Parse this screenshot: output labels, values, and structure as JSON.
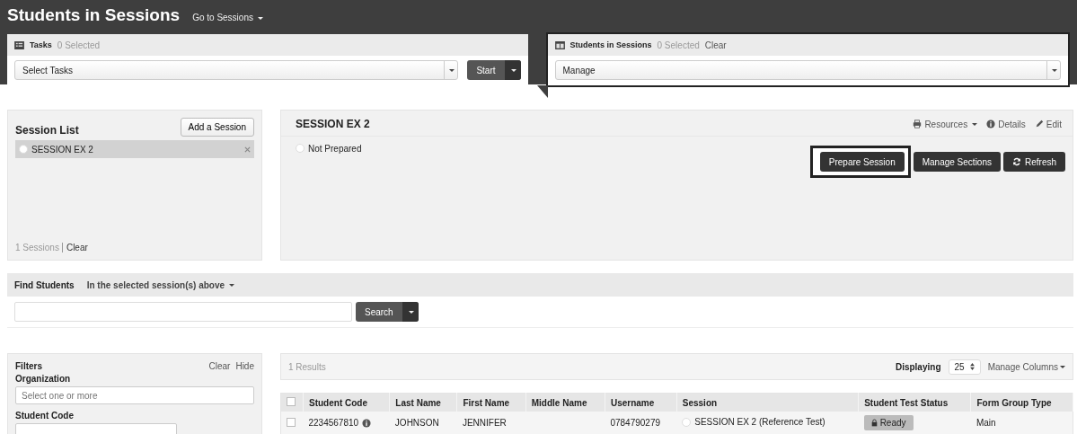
{
  "header": {
    "title": "Students in Sessions",
    "nav_link": "Go to Sessions"
  },
  "tasks_panel": {
    "title": "Tasks",
    "count": "0 Selected",
    "select_value": "Select Tasks",
    "start_button": "Start"
  },
  "students_panel": {
    "title": "Students in Sessions",
    "count": "0 Selected",
    "clear_link": "Clear",
    "select_value": "Manage"
  },
  "session_list": {
    "title": "Session List",
    "add_button": "Add a Session",
    "items": [
      {
        "name": "SESSION EX 2",
        "selected": true,
        "radio_selected": false
      }
    ],
    "count": "1 Sessions",
    "clear_link": "Clear"
  },
  "session_detail": {
    "title": "SESSION EX 2",
    "status": "Not Prepared",
    "resources_link": "Resources",
    "details_link": "Details",
    "edit_link": "Edit",
    "buttons": [
      {
        "label": "Prepare Session",
        "kind": "plain",
        "highlighted": true
      },
      {
        "label": "Manage Sections",
        "kind": "plain",
        "highlighted": false
      },
      {
        "label": "Refresh",
        "kind": "refresh",
        "highlighted": false
      }
    ]
  },
  "find_students": {
    "label": "Find Students",
    "scope": "In the selected session(s) above",
    "search_button": "Search"
  },
  "filters": {
    "title": "Filters",
    "clear_link": "Clear",
    "hide_link": "Hide",
    "groups": [
      {
        "label": "Organization",
        "placeholder": "Select one or more"
      },
      {
        "label": "Student Code"
      }
    ]
  },
  "results": {
    "count": "1 Results",
    "displaying_label": "Displaying",
    "page_size": "25",
    "manage_columns": "Manage Columns",
    "table": {
      "columns": [
        "Student Code",
        "Last Name",
        "First Name",
        "Middle Name",
        "Username",
        "Session",
        "Student Test Status",
        "Form Group Type"
      ],
      "select_all_checked": false,
      "rows": [
        {
          "checked": false,
          "session_selected": false,
          "student_code": "2234567810",
          "last_name": "JOHNSON",
          "first_name": "JENNIFER",
          "username": "0784790279",
          "session": "SESSION EX 2 (Reference Test)",
          "status": "Ready",
          "form_group_type": "Main"
        }
      ]
    }
  }
}
